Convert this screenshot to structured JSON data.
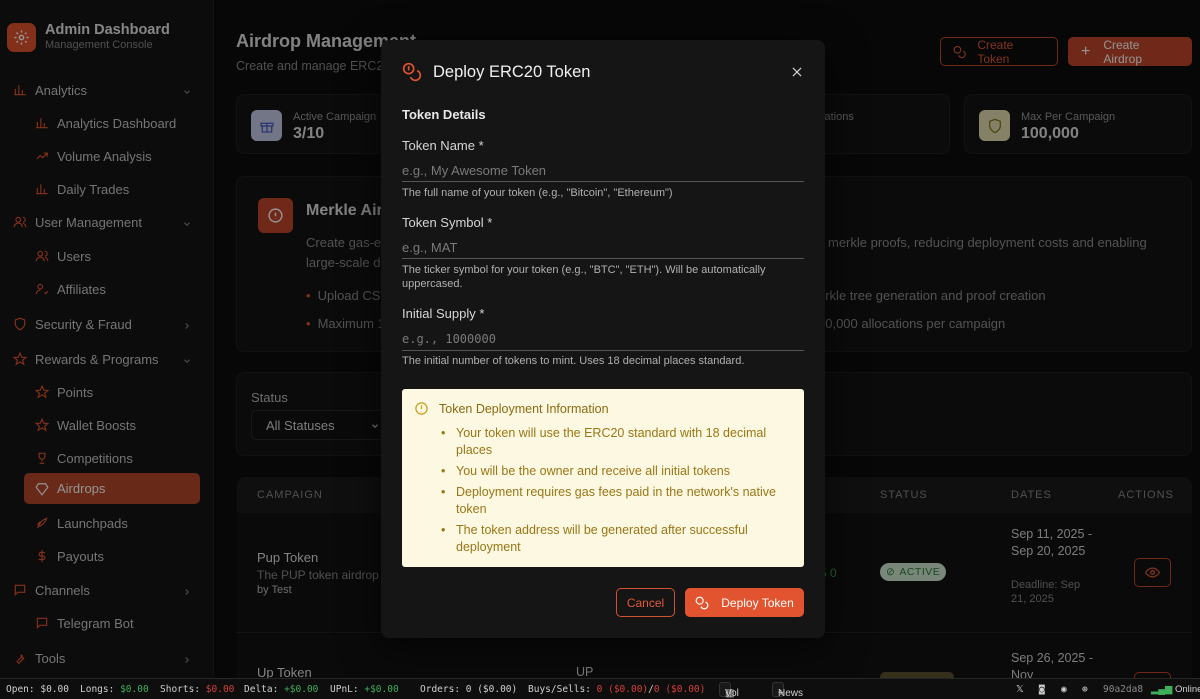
{
  "brand": {
    "title": "Admin Dashboard",
    "subtitle": "Management Console"
  },
  "sidebar": {
    "items": [
      {
        "label": "Analytics",
        "type": "group",
        "icon": "bar-chart-icon"
      },
      {
        "label": "Analytics Dashboard",
        "type": "sub",
        "icon": "bar-chart-icon"
      },
      {
        "label": "Volume Analysis",
        "type": "sub",
        "icon": "trend-up-icon"
      },
      {
        "label": "Daily Trades",
        "type": "sub",
        "icon": "bar-chart-icon"
      },
      {
        "label": "User Management",
        "type": "group",
        "icon": "users-icon"
      },
      {
        "label": "Users",
        "type": "sub",
        "icon": "users-icon"
      },
      {
        "label": "Affiliates",
        "type": "sub",
        "icon": "user-check-icon"
      },
      {
        "label": "Security & Fraud",
        "type": "group",
        "icon": "shield-icon"
      },
      {
        "label": "Rewards & Programs",
        "type": "group",
        "icon": "star-icon"
      },
      {
        "label": "Points",
        "type": "sub",
        "icon": "star-icon"
      },
      {
        "label": "Wallet Boosts",
        "type": "sub",
        "icon": "star-icon"
      },
      {
        "label": "Competitions",
        "type": "sub",
        "icon": "trophy-icon"
      },
      {
        "label": "Airdrops",
        "type": "sub",
        "icon": "gem-icon",
        "active": true
      },
      {
        "label": "Launchpads",
        "type": "sub",
        "icon": "rocket-icon"
      },
      {
        "label": "Payouts",
        "type": "sub",
        "icon": "dollar-icon"
      },
      {
        "label": "Channels",
        "type": "group",
        "icon": "chat-icon"
      },
      {
        "label": "Telegram Bot",
        "type": "sub",
        "icon": "chat-icon"
      },
      {
        "label": "Tools",
        "type": "group",
        "icon": "wrench-icon"
      }
    ]
  },
  "main": {
    "title": "Airdrop Management",
    "subtitle": "Create and manage ERC2",
    "create_token_label": "Create Token",
    "create_airdrop_label": "Create Airdrop",
    "stats": {
      "active_label": "Active Campaign",
      "active_value": "3/10",
      "alloc_label": "cations",
      "max_label": "Max Per Campaign",
      "max_value": "100,000"
    },
    "merkle": {
      "title": "Merkle Air",
      "desc_left_1": "Create gas-e",
      "desc_left_2": "large-scale d",
      "desc_right": "merkle proofs, reducing deployment costs and enabling",
      "bullet1_left": "Upload CSV",
      "bullet1_right": "erkle tree generation and proof creation",
      "bullet2_left": "Maximum 1",
      "bullet2_right": "00,000 allocations per campaign"
    },
    "filter": {
      "label": "Status",
      "value": "All Statuses"
    },
    "table": {
      "headers": {
        "campaign": "CAMPAIGN",
        "status": "STATUS",
        "dates": "DATES",
        "actions": "ACTIONS"
      },
      "rows": [
        {
          "name": "Pup Token",
          "desc": "The PUP token airdrop",
          "by": "by Test",
          "amount": "5 0",
          "status": "ACTIVE",
          "dates": "Sep 11, 2025 - Sep 20, 2025",
          "deadline": "Deadline: Sep 21, 2025"
        },
        {
          "name": "Up Token",
          "symbol": "UP",
          "dates": "Sep 26, 2025 - Nov"
        }
      ]
    }
  },
  "modal": {
    "title": "Deploy ERC20 Token",
    "section": "Token Details",
    "fields": [
      {
        "label": "Token Name *",
        "placeholder": "e.g., My Awesome Token",
        "help": "The full name of your token (e.g., \"Bitcoin\", \"Ethereum\")"
      },
      {
        "label": "Token Symbol *",
        "placeholder": "e.g., MAT",
        "help": "The ticker symbol for your token (e.g., \"BTC\", \"ETH\"). Will be automatically uppercased."
      },
      {
        "label": "Initial Supply *",
        "placeholder": "e.g., 1000000",
        "help": "The initial number of tokens to mint. Uses 18 decimal places standard."
      }
    ],
    "info": {
      "title": "Token Deployment Information",
      "items": [
        "Your token will use the ERC20 standard with 18 decimal places",
        "You will be the owner and receive all initial tokens",
        "Deployment requires gas fees paid in the network's native token",
        "The token address will be generated after successful deployment"
      ]
    },
    "cancel_label": "Cancel",
    "deploy_label": "Deploy Token"
  },
  "footer": {
    "open_label": "Open:",
    "open_value": "$0.00",
    "longs_label": "Longs:",
    "longs_value": "$0.00",
    "shorts_label": "Shorts:",
    "shorts_value": "$0.00",
    "delta_label": "Delta:",
    "delta_value": "+$0.00",
    "upnl_label": "UPnL:",
    "upnl_value": "+$0.00",
    "orders": "Orders: 0 ($0.00)",
    "buys_label": "Buys/Sells:",
    "buys_value": "0 ($0.00)",
    "sep": "/",
    "sells_value": "0 ($0.00)",
    "vol_label": "Vol",
    "news_label": "News",
    "commit": "90a2da8",
    "online": "Online"
  },
  "colors": {
    "accent": "#e2532f",
    "active_bg": "#b4472a",
    "info_bg": "#fdf8e1",
    "success": "#3fae5a",
    "danger": "#d6403a"
  }
}
